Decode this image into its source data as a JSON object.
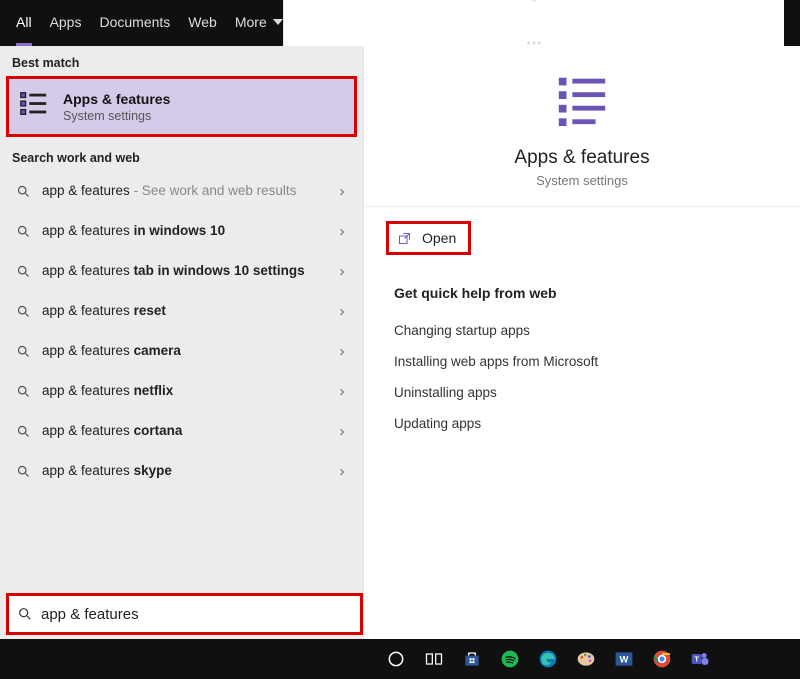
{
  "topbar": {
    "tabs": [
      "All",
      "Apps",
      "Documents",
      "Web",
      "More"
    ],
    "active_index": 0
  },
  "left": {
    "best_match_header": "Best match",
    "best_match": {
      "title": "Apps & features",
      "subtitle": "System settings"
    },
    "search_web_header": "Search work and web",
    "suggestions": [
      {
        "plain": "app & features",
        "bold": "",
        "tail": " - See work and web results",
        "tail_faint": true
      },
      {
        "plain": "app & features ",
        "bold": "in windows 10"
      },
      {
        "plain": "app & features ",
        "bold": "tab in windows 10 settings"
      },
      {
        "plain": "app & features ",
        "bold": "reset"
      },
      {
        "plain": "app & features ",
        "bold": "camera"
      },
      {
        "plain": "app & features ",
        "bold": "netflix"
      },
      {
        "plain": "app & features ",
        "bold": "cortana"
      },
      {
        "plain": "app & features ",
        "bold": "skype"
      }
    ],
    "search_value": "app & features"
  },
  "right": {
    "title": "Apps & features",
    "subtitle": "System settings",
    "open_label": "Open",
    "help_header": "Get quick help from web",
    "help_links": [
      "Changing startup apps",
      "Installing web apps from Microsoft",
      "Uninstalling apps",
      "Updating apps"
    ]
  },
  "taskbar": {
    "icons": [
      "cortana",
      "task-view",
      "store",
      "spotify",
      "edge",
      "paint",
      "word",
      "chrome",
      "teams"
    ]
  }
}
